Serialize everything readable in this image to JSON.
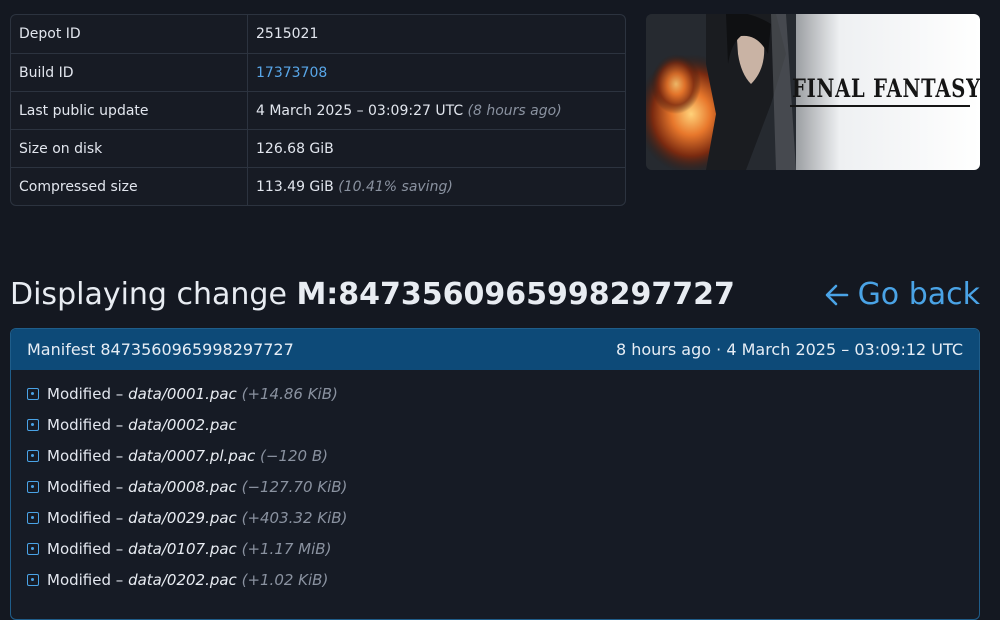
{
  "info": {
    "rows": [
      {
        "label": "Depot ID",
        "value": "2515021",
        "note": ""
      },
      {
        "label": "Build ID",
        "value": "17373708",
        "note": ""
      },
      {
        "label": "Last public update",
        "value": "4 March 2025 – 03:09:27 UTC ",
        "note": "(8 hours ago)"
      },
      {
        "label": "Size on disk",
        "value": "126.68 GiB",
        "note": ""
      },
      {
        "label": "Compressed size",
        "value": "113.49 GiB ",
        "note": "(10.41% saving)"
      }
    ]
  },
  "banner": {
    "logo_text": "FINAL FANTASY XVI"
  },
  "heading": {
    "prefix": "Displaying change ",
    "manifest_id": "M:8473560965998297727",
    "go_back": "Go back"
  },
  "manifest": {
    "title": "Manifest 8473560965998297727",
    "time": "8 hours ago · 4 March 2025 – 03:09:12 UTC",
    "changes": [
      {
        "kind": "Modified",
        "path": "data/0001.pac",
        "delta": "(+14.86 KiB)"
      },
      {
        "kind": "Modified",
        "path": "data/0002.pac",
        "delta": ""
      },
      {
        "kind": "Modified",
        "path": "data/0007.pl.pac",
        "delta": "(−120 B)"
      },
      {
        "kind": "Modified",
        "path": "data/0008.pac",
        "delta": "(−127.70 KiB)"
      },
      {
        "kind": "Modified",
        "path": "data/0029.pac",
        "delta": "(+403.32 KiB)"
      },
      {
        "kind": "Modified",
        "path": "data/0107.pac",
        "delta": "(+1.17 MiB)"
      },
      {
        "kind": "Modified",
        "path": "data/0202.pac",
        "delta": "(+1.02 KiB)"
      }
    ]
  },
  "colors": {
    "background": "#141821",
    "accent": "#4aa3e6",
    "panel_header": "#0d4a78"
  }
}
